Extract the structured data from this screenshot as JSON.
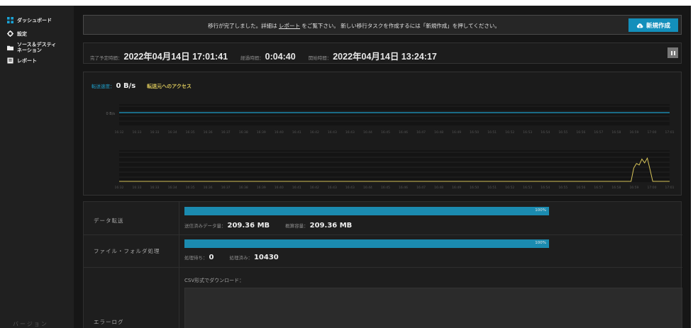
{
  "sidebar": {
    "items": [
      {
        "label": "ダッシュボード",
        "icon": "dashboard-icon"
      },
      {
        "label": "設定",
        "icon": "gear-icon"
      },
      {
        "label": "ソース＆デスティ\nネーション",
        "icon": "folder-icon"
      },
      {
        "label": "レポート",
        "icon": "report-icon"
      }
    ],
    "version": "バージョン"
  },
  "notice": {
    "before": "移行が完了しました。詳細は",
    "link": "レポート",
    "after": "をご覧下さい。 新しい移行タスクを作成するには「新規作成」を押してください。",
    "new_button": "新規作成"
  },
  "times": {
    "eta_label": "完了予定時間：",
    "eta_value": "2022年04月14日 17:01:41",
    "elapsed_label": "経過時間：",
    "elapsed_value": "0:04:40",
    "start_label": "開始時間：",
    "start_value": "2022年04月14日 13:24:17"
  },
  "chart_header": {
    "speed_label": "転送速度：",
    "speed_value": "0 B/s",
    "access_link": "転送元へのアクセス"
  },
  "chart_data": [
    {
      "type": "line",
      "ytick_labels": [
        "0 B/s"
      ],
      "x": [
        "16:32",
        "16:33",
        "16:33",
        "16:34",
        "16:35",
        "16:36",
        "16:37",
        "16:38",
        "16:39",
        "16:40",
        "16:41",
        "16:42",
        "16:43",
        "16:43",
        "16:44",
        "16:45",
        "16:46",
        "16:47",
        "16:48",
        "16:49",
        "16:50",
        "16:51",
        "16:52",
        "16:53",
        "16:54",
        "16:55",
        "16:56",
        "16:57",
        "16:58",
        "16:59",
        "17:00",
        "17:01"
      ],
      "series": [
        {
          "color": "#1e9ec9",
          "values": [
            0,
            0,
            0,
            0,
            0,
            0,
            0,
            0,
            0,
            0,
            0,
            0,
            0,
            0,
            0,
            0,
            0,
            0,
            0,
            0,
            0,
            0,
            0,
            0,
            0,
            0,
            0,
            0,
            0,
            0,
            0,
            0
          ]
        }
      ]
    },
    {
      "type": "line",
      "x": [
        "16:32",
        "16:33",
        "16:33",
        "16:34",
        "16:35",
        "16:36",
        "16:37",
        "16:38",
        "16:39",
        "16:40",
        "16:41",
        "16:42",
        "16:43",
        "16:43",
        "16:44",
        "16:45",
        "16:46",
        "16:47",
        "16:48",
        "16:49",
        "16:50",
        "16:51",
        "16:52",
        "16:53",
        "16:54",
        "16:55",
        "16:56",
        "16:57",
        "16:58",
        "16:59",
        "17:00",
        "17:01"
      ],
      "ylim": [
        0,
        10
      ],
      "series": [
        {
          "color": "#d8c55a",
          "values": [
            0,
            0,
            0,
            0,
            0,
            0,
            0,
            0,
            0,
            0,
            0,
            0,
            0,
            0,
            0,
            0,
            0,
            0,
            0,
            0,
            0,
            0,
            0,
            0,
            0,
            0,
            0,
            0,
            0,
            0,
            0,
            0
          ],
          "spike": [
            0,
            0,
            0,
            4.5,
            6,
            5.5,
            7.5,
            6.2,
            7.8,
            4,
            0,
            0
          ]
        }
      ]
    }
  ],
  "stats": {
    "data_transfer": {
      "label": "データ転送",
      "progress": 100,
      "pct_text": "100%",
      "sent_label": "送信済みデータ量：",
      "sent_value": "209.36 MB",
      "total_label": "概算容量：",
      "total_value": "209.36 MB"
    },
    "files": {
      "label": "ファイル・フォルダ処理",
      "progress": 100,
      "pct_text": "100%",
      "waiting_label": "処理待ち：",
      "waiting_value": "0",
      "done_label": "処理済み：",
      "done_value": "10430"
    },
    "csv_label": "CSV形式でダウンロード：",
    "error_log_label": "エラーログ"
  },
  "colors": {
    "accent": "#138fbb",
    "bar": "#1b8bb0",
    "speed_line": "#1e9ec9",
    "access_line": "#d8c55a"
  }
}
